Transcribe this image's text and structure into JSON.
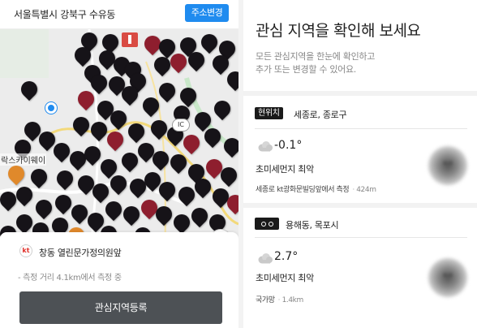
{
  "left": {
    "address": "서울특별시 강북구 수유동",
    "change_address_button": "주소변경",
    "map": {
      "ic_label": "IC",
      "place_label": "락스카이웨이"
    },
    "sheet": {
      "provider_logo": "kt",
      "station_name": "창동 열린문가정의원앞",
      "measure_note": "- 측정 거리 4.1km에서 측정 중",
      "register_button": "관심지역등록"
    }
  },
  "right": {
    "title": "관심 지역을 확인해 보세요",
    "subtitle_line1": "모든 관심지역을 한눈에 확인하고",
    "subtitle_line2": "추가 또는 변경할 수 있어요.",
    "cards": [
      {
        "tag": "현위치",
        "location": "세종로, 종로구",
        "temperature": "-0.1°",
        "grade": "초미세먼지 최악",
        "station": "세종로 kt광화문빌딩앞에서 측정",
        "distance": "424m"
      },
      {
        "tag": "",
        "location": "용해동, 목포시",
        "temperature": "2.7°",
        "grade": "초미세먼지 최악",
        "station": "국가망",
        "distance": "1.4km"
      }
    ]
  },
  "colors": {
    "accent": "#1f8bef",
    "pin_dark": "#161318",
    "pin_red": "#8e1e2e",
    "register_button_bg": "#4d5155"
  }
}
